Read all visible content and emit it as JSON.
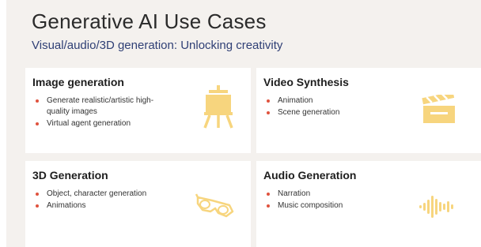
{
  "header": {
    "title": "Generative AI Use Cases",
    "subtitle": "Visual/audio/3D generation: Unlocking creativity"
  },
  "colors": {
    "background": "#f4f1ee",
    "card": "#ffffff",
    "bullet": "#e0533e",
    "icon": "#f7d57e",
    "subtitle": "#2f3f75"
  },
  "cards": [
    {
      "title": "Image generation",
      "icon": "easel-icon",
      "items": [
        "Generate realistic/artistic high-quality images",
        "Virtual agent generation"
      ]
    },
    {
      "title": "Video Synthesis",
      "icon": "clapperboard-icon",
      "items": [
        "Animation",
        "Scene generation"
      ]
    },
    {
      "title": "3D Generation",
      "icon": "3d-glasses-icon",
      "items": [
        "Object, character generation",
        "Animations"
      ]
    },
    {
      "title": "Audio Generation",
      "icon": "sound-wave-icon",
      "items": [
        "Narration",
        "Music composition"
      ]
    }
  ]
}
